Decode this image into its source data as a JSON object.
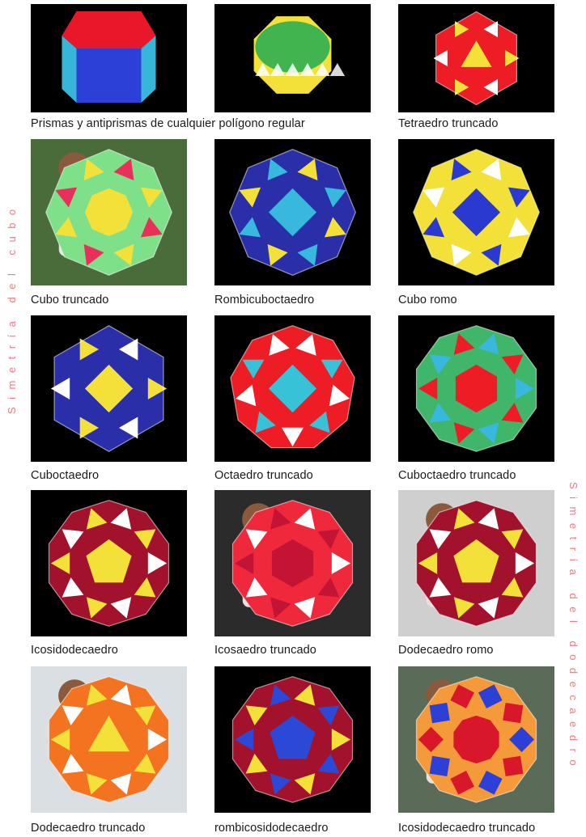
{
  "side_labels": {
    "cube_symmetry": "Simetría del cubo",
    "dodecahedron_symmetry": "Simetría del dodecaedro"
  },
  "items": [
    {
      "caption": "Prismas y antiprismas de cualquier polígono regular",
      "colors": [
        "#e8182a",
        "#2c3fd6",
        "#36b6d8"
      ]
    },
    {
      "caption": "",
      "colors": [
        "#41b44f",
        "#f3e13a",
        "#ffffff"
      ]
    },
    {
      "caption": "Tetraedro truncado",
      "colors": [
        "#ee1c24",
        "#f3e13a",
        "#ffffff"
      ]
    },
    {
      "caption": "Cubo truncado",
      "colors": [
        "#7fe08a",
        "#f3e13a",
        "#e9305a"
      ]
    },
    {
      "caption": "Rombicuboctaedro",
      "colors": [
        "#2a2ea8",
        "#37b8dc",
        "#f3e13a"
      ]
    },
    {
      "caption": "Cubo romo",
      "colors": [
        "#f3e13a",
        "#2a3ad0",
        "#ffffff"
      ]
    },
    {
      "caption": "Cuboctaedro",
      "colors": [
        "#2a2ea8",
        "#f3e13a",
        "#ffffff"
      ]
    },
    {
      "caption": "Octaedro truncado",
      "colors": [
        "#ee1c24",
        "#37c2d8",
        "#ffffff"
      ]
    },
    {
      "caption": "Cuboctaedro truncado",
      "colors": [
        "#3fb66a",
        "#ee1c24",
        "#37b8dc"
      ]
    },
    {
      "caption": "Icosidodecaedro",
      "colors": [
        "#a3122c",
        "#f3e13a",
        "#ffffff"
      ]
    },
    {
      "caption": "Icosaedro truncado",
      "colors": [
        "#f0283c",
        "#c31436",
        "#ffffff"
      ]
    },
    {
      "caption": "Dodecaedro romo",
      "colors": [
        "#a3122c",
        "#f3e13a",
        "#ffffff"
      ]
    },
    {
      "caption": "Dodecaedro truncado",
      "colors": [
        "#f47320",
        "#f3e13a",
        "#ffffff"
      ]
    },
    {
      "caption": "rombicosidodecaedro",
      "colors": [
        "#a3122c",
        "#2c48d6",
        "#f3e13a"
      ]
    },
    {
      "caption": "Icosidodecaedro truncado",
      "colors": [
        "#f59a3a",
        "#d8182a",
        "#2c3fd6"
      ]
    }
  ]
}
